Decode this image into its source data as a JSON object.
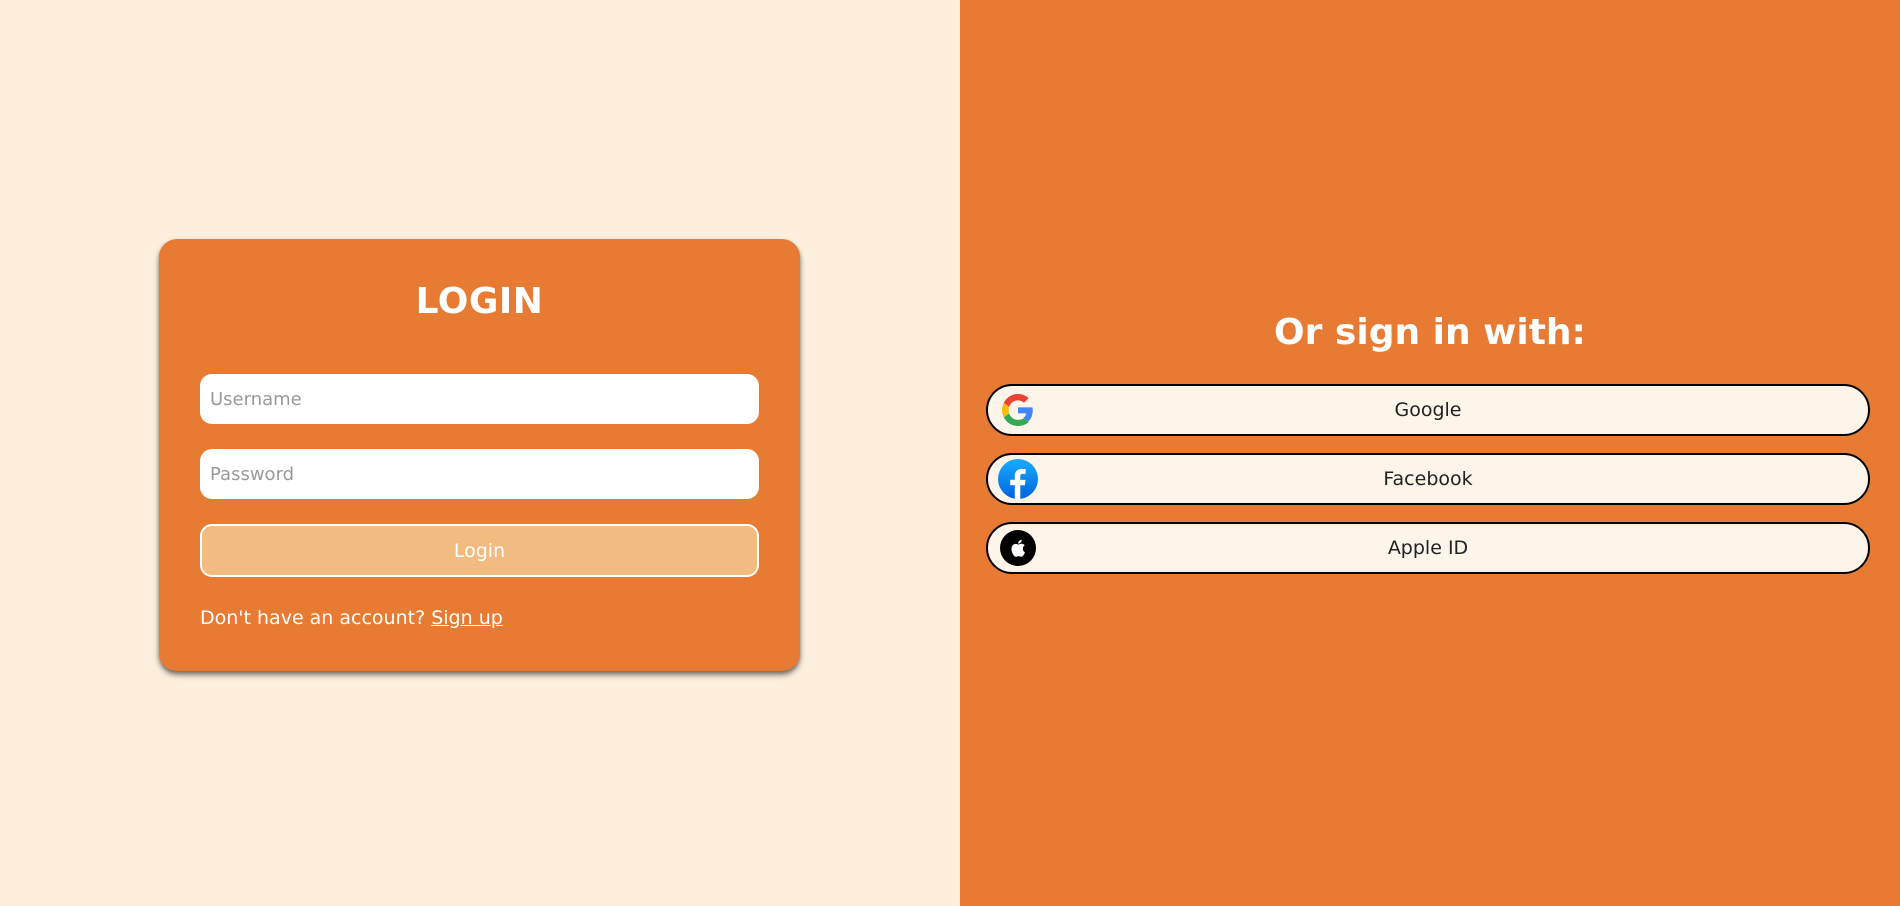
{
  "login_card": {
    "title": "LOGIN",
    "username_placeholder": "Username",
    "password_placeholder": "Password",
    "login_button_label": "Login",
    "signup_prompt": "Don't have an account?",
    "signup_link_label": "Sign up"
  },
  "social": {
    "title": "Or sign in with:",
    "buttons": [
      {
        "label": "Google",
        "icon": "google-icon"
      },
      {
        "label": "Facebook",
        "icon": "facebook-icon"
      },
      {
        "label": "Apple ID",
        "icon": "apple-icon"
      }
    ]
  },
  "colors": {
    "left_background": "#fdefdc",
    "accent_orange": "#e77b33",
    "login_button": "#f2bb80",
    "social_button_bg": "#fdf4ea"
  }
}
